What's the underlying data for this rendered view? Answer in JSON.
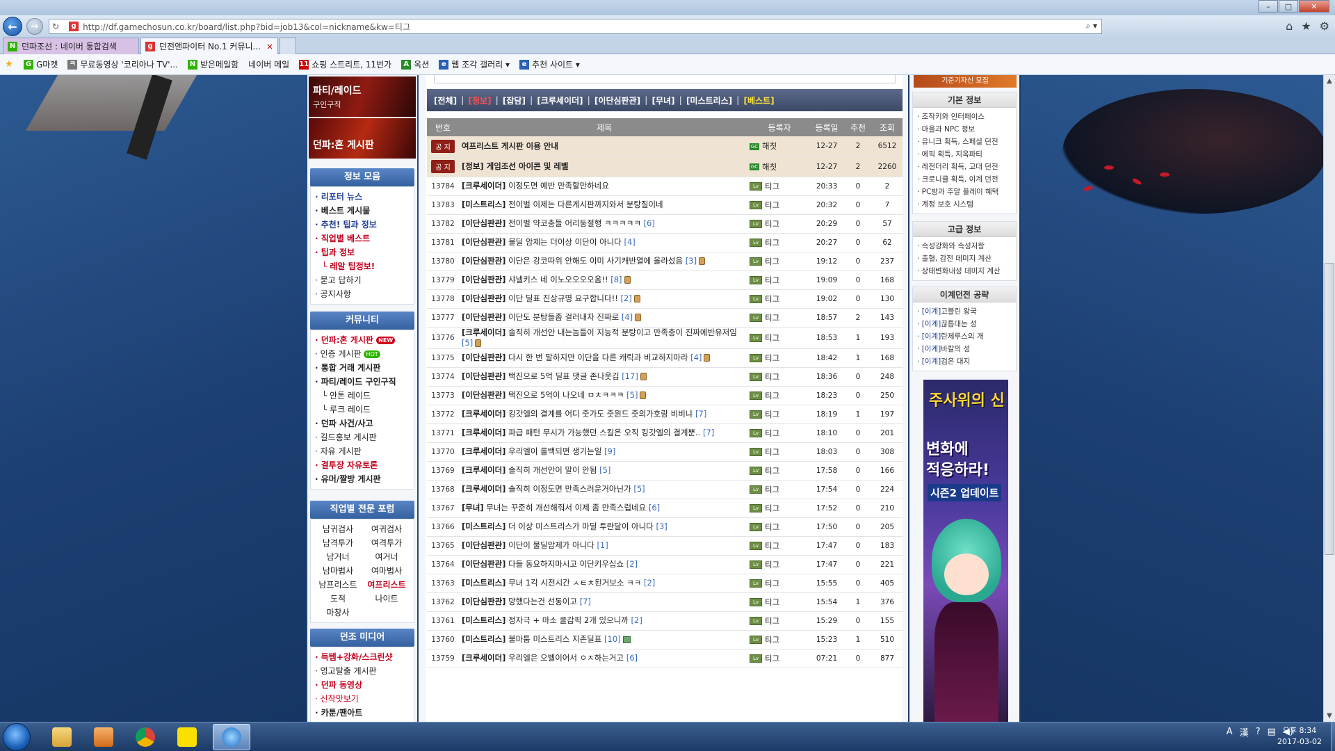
{
  "browser": {
    "url": "http://df.gamechosun.co.kr/board/list.php?bid=job13&col=nickname&kw=티그",
    "favicon_letter": "g",
    "tabs": [
      {
        "label": "던파조선 : 네이버 통합검색",
        "favicon": "N"
      },
      {
        "label": "던전앤파이터 No.1 커뮤니...",
        "favicon": "g",
        "close": "×"
      }
    ],
    "favorites": [
      {
        "label": "",
        "icon": "★"
      },
      {
        "label": "G마켓",
        "icon": "G"
      },
      {
        "label": "무료동영상 '코리아나 TV'...",
        "icon": "ㅋ"
      },
      {
        "label": "받은메일함",
        "icon": "N"
      },
      {
        "label": "네이버 메일",
        "icon": ""
      },
      {
        "label": "쇼핑 스트리트, 11번가",
        "icon": "11"
      },
      {
        "label": "옥션",
        "icon": "A"
      },
      {
        "label": "웹 조각 갤러리 ▾",
        "icon": "e"
      },
      {
        "label": "추천 사이트 ▾",
        "icon": "e"
      }
    ]
  },
  "left_sidebar": {
    "banners": [
      {
        "title": "파티/레이드",
        "sub": "구인구직"
      },
      {
        "title": "던파:혼 게시판",
        "sub": ""
      }
    ],
    "info": {
      "header": "정보 모음",
      "items": [
        {
          "label": "· 리포터 뉴스",
          "style": "blue"
        },
        {
          "label": "· 베스트 게시물",
          "style": "bold"
        },
        {
          "label": "· 추천! 팁과 정보",
          "style": "blue"
        },
        {
          "label": "· 직업별 베스트",
          "style": "red"
        },
        {
          "label": "· 팁과 정보",
          "style": "red"
        },
        {
          "label": "└ 레알 팁정보!",
          "style": "sub red"
        },
        {
          "label": "· 묻고 답하기",
          "style": ""
        },
        {
          "label": "· 공지사항",
          "style": ""
        }
      ]
    },
    "community": {
      "header": "커뮤니티",
      "items": [
        {
          "label": "· 던파:혼 게시판",
          "style": "red",
          "badge": "NEW"
        },
        {
          "label": "· 인증 게시판",
          "style": "",
          "badge": "HOT"
        },
        {
          "label": "· 통합 거래 게시판",
          "style": "bold",
          "badge": ""
        },
        {
          "label": "· 파티/레이드 구인구직",
          "style": "bold",
          "badge": ""
        },
        {
          "label": "└ 안톤 레이드",
          "style": "sub",
          "badge": ""
        },
        {
          "label": "└ 루크 레이드",
          "style": "sub",
          "badge": ""
        },
        {
          "label": "· 던파 사건/사고",
          "style": "bold",
          "badge": ""
        },
        {
          "label": "· 길드홍보 게시판",
          "style": "",
          "badge": ""
        },
        {
          "label": "· 자유 게시판",
          "style": "",
          "badge": ""
        },
        {
          "label": "· 결투장 자유토론",
          "style": "red",
          "badge": ""
        },
        {
          "label": "· 유머/짤방 게시판",
          "style": "bold",
          "badge": ""
        }
      ]
    },
    "jobs": {
      "header": "직업별 전문 포럼",
      "items": [
        {
          "label": "남귀검사",
          "style": ""
        },
        {
          "label": "여귀검사",
          "style": ""
        },
        {
          "label": "남격투가",
          "style": ""
        },
        {
          "label": "여격투가",
          "style": ""
        },
        {
          "label": "남거너",
          "style": ""
        },
        {
          "label": "여거너",
          "style": ""
        },
        {
          "label": "남마법사",
          "style": ""
        },
        {
          "label": "여마법사",
          "style": ""
        },
        {
          "label": "남프리스트",
          "style": ""
        },
        {
          "label": "여프리스트",
          "style": "red"
        },
        {
          "label": "도적",
          "style": ""
        },
        {
          "label": "나이트",
          "style": ""
        },
        {
          "label": "마창사",
          "style": ""
        }
      ]
    },
    "media": {
      "header": "던조 미디어",
      "items": [
        {
          "label": "· 득템+강화/스크린샷",
          "style": "red"
        },
        {
          "label": "· 영고탈출 게시판",
          "style": ""
        },
        {
          "label": "· 던파 동영상",
          "style": "red"
        },
        {
          "label": "· 신작맛보기",
          "style": "red2"
        },
        {
          "label": "· 카툰/팬아트",
          "style": "bold"
        }
      ]
    }
  },
  "board": {
    "categories": [
      {
        "label": "[전체]",
        "state": ""
      },
      {
        "label": "[정보]",
        "state": "cur"
      },
      {
        "label": "[잡담]",
        "state": ""
      },
      {
        "label": "[크루세이더]",
        "state": ""
      },
      {
        "label": "[이단심판관]",
        "state": ""
      },
      {
        "label": "[무녀]",
        "state": ""
      },
      {
        "label": "[미스트리스]",
        "state": ""
      },
      {
        "label": "[베스트]",
        "state": "best"
      }
    ],
    "separator": "|",
    "columns": {
      "no": "번호",
      "title": "제목",
      "writer": "등록자",
      "date": "등록일",
      "rec": "추천",
      "view": "조회"
    },
    "notice_badge": "공 지",
    "notices": [
      {
        "title": "여프리스트 게시판 이용 안내",
        "writer": "해칫",
        "date": "12-27",
        "rec": "2",
        "view": "6512"
      },
      {
        "title": "[정보] 게임조선 아이콘 및 레벨",
        "writer": "해칫",
        "date": "12-27",
        "rec": "2",
        "view": "2260"
      }
    ],
    "rows": [
      {
        "no": "13784",
        "cat": "[크루세이더]",
        "text": " 이정도면 예반 만족할만하네요",
        "cnt": "",
        "icon": "",
        "writer": "티그",
        "date": "20:33",
        "rec": "0",
        "view": "2"
      },
      {
        "no": "13783",
        "cat": "[미스트리스]",
        "text": " 전이벌 이제는 다른게시판까지와서 분탕질이네",
        "cnt": "",
        "icon": "",
        "writer": "티그",
        "date": "20:32",
        "rec": "0",
        "view": "7"
      },
      {
        "no": "13782",
        "cat": "[이단심판관]",
        "text": " 전이벌 약코충들 어리둥절행 ㅋㅋㅋㅋㅋ ",
        "cnt": "[6]",
        "icon": "",
        "writer": "티그",
        "date": "20:29",
        "rec": "0",
        "view": "57"
      },
      {
        "no": "13781",
        "cat": "[이단심판관]",
        "text": " 물딜 암제는 더이상 이단이 아니다 ",
        "cnt": "[4]",
        "icon": "",
        "writer": "티그",
        "date": "20:27",
        "rec": "0",
        "view": "62"
      },
      {
        "no": "13780",
        "cat": "[이단심판관]",
        "text": " 이단은 강코따위 안해도 이미 사기캐반열에 올라섰음 ",
        "cnt": "[3]",
        "icon": "lock",
        "writer": "티그",
        "date": "19:12",
        "rec": "0",
        "view": "237",
        "tall": true
      },
      {
        "no": "13779",
        "cat": "[이단심판관]",
        "text": " 샤넬키스 네 이노오오오오옴!! ",
        "cnt": "[8]",
        "icon": "lock",
        "writer": "티그",
        "date": "19:09",
        "rec": "0",
        "view": "168"
      },
      {
        "no": "13778",
        "cat": "[이단심판관]",
        "text": " 이단 딜표 진상규명 요구합니다!! ",
        "cnt": "[2]",
        "icon": "lock",
        "writer": "티그",
        "date": "19:02",
        "rec": "0",
        "view": "130"
      },
      {
        "no": "13777",
        "cat": "[이단심판관]",
        "text": " 이단도 분탕들좀 걸러내자 진짜로 ",
        "cnt": "[4]",
        "icon": "lock",
        "writer": "티그",
        "date": "18:57",
        "rec": "2",
        "view": "143"
      },
      {
        "no": "13776",
        "cat": "[크루세이더]",
        "text": " 솔직히 개선안 내는놈들이 지능적 분탕이고 만족충이 진짜에반유저임 ",
        "cnt": "[5]",
        "icon": "lock",
        "writer": "티그",
        "date": "18:53",
        "rec": "1",
        "view": "193",
        "tall": true
      },
      {
        "no": "13775",
        "cat": "[이단심판관]",
        "text": " 다시 한 번 말하지만 이단을 다른 캐릭과 비교하지마라 ",
        "cnt": "[4]",
        "icon": "lock",
        "writer": "티그",
        "date": "18:42",
        "rec": "1",
        "view": "168",
        "tall": true
      },
      {
        "no": "13774",
        "cat": "[이단심판관]",
        "text": " 택진으로 5억 딜표 댓글 존나웃김 ",
        "cnt": "[17]",
        "icon": "lock",
        "writer": "티그",
        "date": "18:36",
        "rec": "0",
        "view": "248"
      },
      {
        "no": "13773",
        "cat": "[이단심판관]",
        "text": " 택진으로 5억이 나오네 ㅁㅊㅋㅋㅋ ",
        "cnt": "[5]",
        "icon": "lock",
        "writer": "티그",
        "date": "18:23",
        "rec": "0",
        "view": "250"
      },
      {
        "no": "13772",
        "cat": "[크루세이더]",
        "text": " 킹갓엘의 결계를 어디 줏가도 줏윈드 줏의가호랑 비비냐 ",
        "cnt": "[7]",
        "icon": "",
        "writer": "티그",
        "date": "18:19",
        "rec": "1",
        "view": "197",
        "tall": true
      },
      {
        "no": "13771",
        "cat": "[크루세이더]",
        "text": " 파급 패턴 무시가 가능했던 스킬은 오직 킹갓엘의 결계뿐.. ",
        "cnt": "[7]",
        "icon": "",
        "writer": "티그",
        "date": "18:10",
        "rec": "0",
        "view": "201",
        "tall": true
      },
      {
        "no": "13770",
        "cat": "[크루세이더]",
        "text": " 우리엘이 롤백되면 생기는일 ",
        "cnt": "[9]",
        "icon": "",
        "writer": "티그",
        "date": "18:03",
        "rec": "0",
        "view": "308"
      },
      {
        "no": "13769",
        "cat": "[크루세이더]",
        "text": " 솔직히 개선안이 말이 안됨 ",
        "cnt": "[5]",
        "icon": "",
        "writer": "티그",
        "date": "17:58",
        "rec": "0",
        "view": "166"
      },
      {
        "no": "13768",
        "cat": "[크루세이더]",
        "text": " 솔직히 이정도면 만족스러운거아닌가 ",
        "cnt": "[5]",
        "icon": "",
        "writer": "티그",
        "date": "17:54",
        "rec": "0",
        "view": "224"
      },
      {
        "no": "13767",
        "cat": "[무녀]",
        "text": " 무녀는 꾸준히 개선해줘서 이제 좀 만족스럽네요 ",
        "cnt": "[6]",
        "icon": "",
        "writer": "티그",
        "date": "17:52",
        "rec": "0",
        "view": "210"
      },
      {
        "no": "13766",
        "cat": "[미스트리스]",
        "text": " 더 이상 미스트리스가 마딜 투란달이 아니다 ",
        "cnt": "[3]",
        "icon": "",
        "writer": "티그",
        "date": "17:50",
        "rec": "0",
        "view": "205"
      },
      {
        "no": "13765",
        "cat": "[이단심판관]",
        "text": " 이단이 물딜암제가 아니다 ",
        "cnt": "[1]",
        "icon": "",
        "writer": "티그",
        "date": "17:47",
        "rec": "0",
        "view": "183"
      },
      {
        "no": "13764",
        "cat": "[이단심판관]",
        "text": " 다들 동요하지마시고 이단키우십쇼 ",
        "cnt": "[2]",
        "icon": "",
        "writer": "티그",
        "date": "17:47",
        "rec": "0",
        "view": "221"
      },
      {
        "no": "13763",
        "cat": "[미스트리스]",
        "text": " 무녀 1각 시전시간 ㅅㅌㅊ된거보소 ㅋㅋ ",
        "cnt": "[2]",
        "icon": "",
        "writer": "티그",
        "date": "15:55",
        "rec": "0",
        "view": "405"
      },
      {
        "no": "13762",
        "cat": "[이단심판관]",
        "text": " 망했다는건 선동이고 ",
        "cnt": "[7]",
        "icon": "",
        "writer": "티그",
        "date": "15:54",
        "rec": "1",
        "view": "376"
      },
      {
        "no": "13761",
        "cat": "[미스트리스]",
        "text": " 정자극 + 마소 쿨감픽 2개 있으니까 ",
        "cnt": "[2]",
        "icon": "",
        "writer": "티그",
        "date": "15:29",
        "rec": "0",
        "view": "155"
      },
      {
        "no": "13760",
        "cat": "[미스트리스]",
        "text": " 불마툼 미스트리스 지존딜표 ",
        "cnt": "[10]",
        "icon": "img",
        "writer": "티그",
        "date": "15:23",
        "rec": "1",
        "view": "510"
      },
      {
        "no": "13759",
        "cat": "[크루세이더]",
        "text": " 우리엘은 오벨이어서 ㅇㅈ하는거고 ",
        "cnt": "[6]",
        "icon": "",
        "writer": "티그",
        "date": "07:21",
        "rec": "0",
        "view": "877"
      }
    ]
  },
  "right_sidebar": {
    "top_banner": "기준기자신 모집",
    "basic": {
      "header": "기본 정보",
      "items": [
        "· 조작키와 인터페이스",
        "· 마을과 NPC 정보",
        "· 유니크 획득, 스페셜 던전",
        "· 에픽 획득, 지옥파티",
        "· 레전더리 획득, 고대 던전",
        "· 크로니클 획득, 이계 던전",
        "· PC방과 주말 플레이 혜택",
        "· 계정 보호 시스템"
      ]
    },
    "advanced": {
      "header": "고급 정보",
      "items": [
        "· 속성강화와 속성저항",
        "· 출혈, 감전 데미지 계산",
        "· 상태변화내성 데미지 계산"
      ]
    },
    "otherworld": {
      "header": "이계던전 공략",
      "tag": "[이계]",
      "items": [
        "고블린 왕국",
        "끊틈대는 성",
        "란제루스의 개",
        "바칼의 성",
        "검은 대지"
      ]
    },
    "ad": {
      "title": "주사위의 신",
      "line1": "변화에",
      "line2": "적응하라!",
      "line3": "시즌2 업데이트"
    }
  },
  "taskbar": {
    "apps": [
      "explorer",
      "media",
      "chrome",
      "talk",
      "ie"
    ],
    "tray": [
      "A",
      "漢"
    ],
    "time": "오후 8:34",
    "date": "2017-03-02"
  }
}
